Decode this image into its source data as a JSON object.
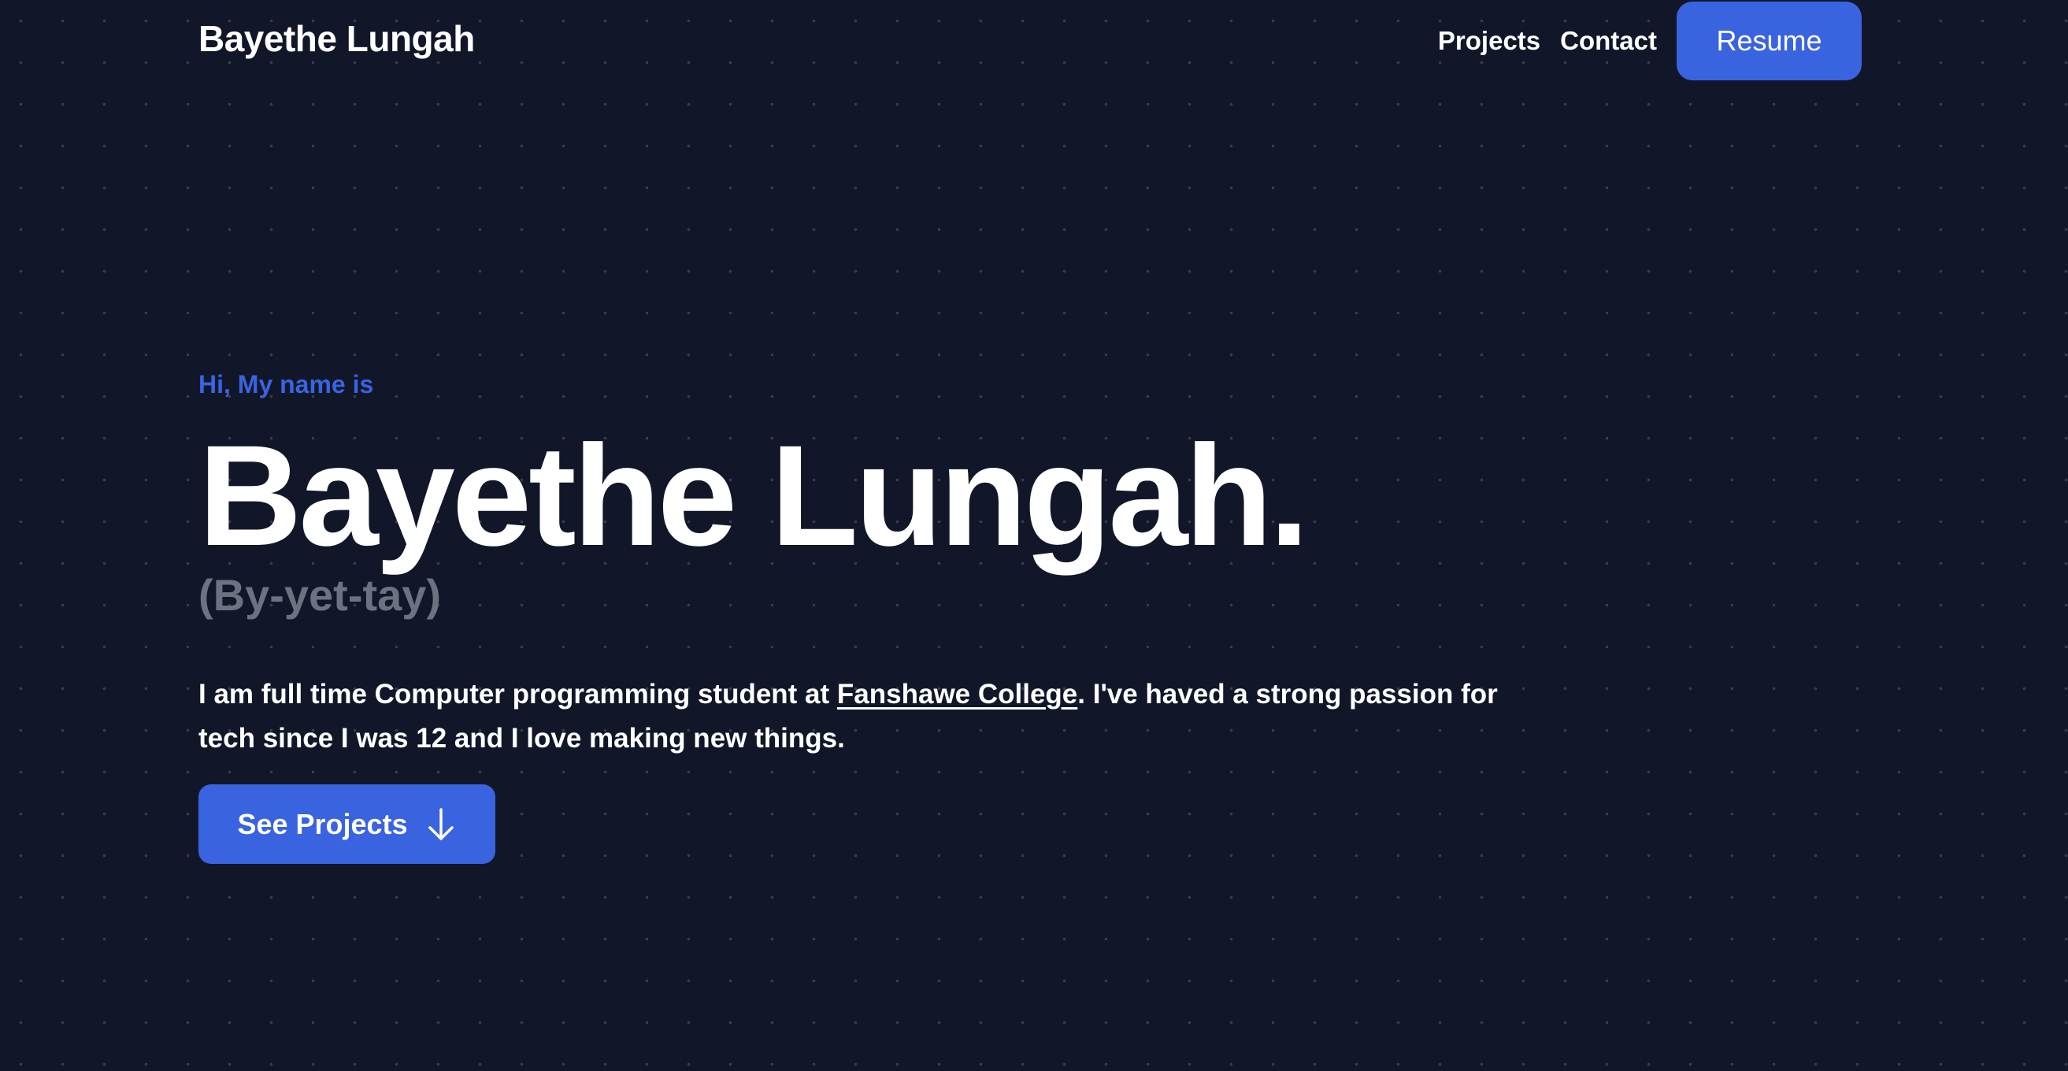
{
  "header": {
    "brand": "Bayethe Lungah",
    "nav_links": [
      "Projects",
      "Contact"
    ],
    "resume_label": "Resume"
  },
  "hero": {
    "greeting": "Hi, My name is",
    "name": "Bayethe Lungah.",
    "pronunciation": "(By-yet-tay)",
    "bio_prefix": "I am full time Computer programming student at ",
    "bio_link": "Fanshawe College",
    "bio_suffix": ". I've haved a strong passion for tech since I was 12 and I love making new things.",
    "cta_label": "See Projects",
    "cta_icon": "arrow-down-icon"
  },
  "colors": {
    "background": "#111729",
    "accent": "#3a63e0",
    "muted": "#6b7280",
    "text": "#ffffff"
  }
}
